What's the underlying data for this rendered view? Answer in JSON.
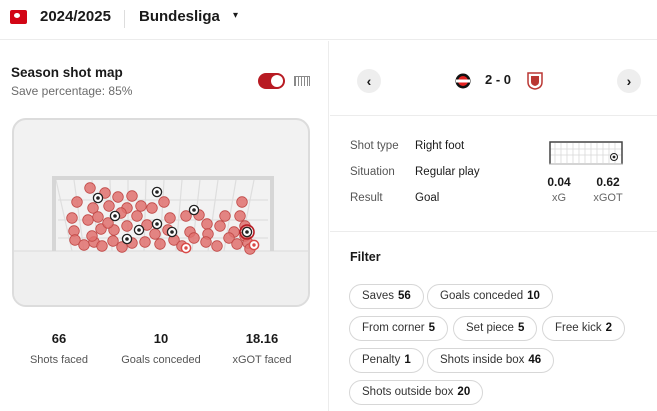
{
  "header": {
    "season": "2024/2025",
    "league": "Bundesliga",
    "caret": "▾"
  },
  "left": {
    "title": "Season shot map",
    "subtitle": "Save percentage: 85%",
    "stats": [
      {
        "value": "66",
        "label": "Shots faced"
      },
      {
        "value": "10",
        "label": "Goals conceded"
      },
      {
        "value": "18.16",
        "label": "xGOT faced"
      }
    ]
  },
  "match": {
    "prev": "‹",
    "next": "›",
    "score": "2 - 0",
    "home_badge_color": "#e32221",
    "away_badge_color": "#ba3733"
  },
  "details": [
    {
      "key": "Shot type",
      "value": "Right foot"
    },
    {
      "key": "Situation",
      "value": "Regular play"
    },
    {
      "key": "Result",
      "value": "Goal"
    }
  ],
  "xg": [
    {
      "value": "0.04",
      "label": "xG"
    },
    {
      "value": "0.62",
      "label": "xGOT"
    }
  ],
  "filter": {
    "title": "Filter",
    "chips": [
      {
        "label": "Saves",
        "count": "56"
      },
      {
        "label": "Goals conceded",
        "count": "10"
      },
      {
        "label": "From corner",
        "count": "5"
      },
      {
        "label": "Set piece",
        "count": "5"
      },
      {
        "label": "Free kick",
        "count": "2"
      },
      {
        "label": "Penalty",
        "count": "1"
      },
      {
        "label": "Shots inside box",
        "count": "46"
      },
      {
        "label": "Shots outside box",
        "count": "20"
      }
    ]
  },
  "colors": {
    "save_dot": "#e0716f",
    "accent": "#b81b23"
  }
}
